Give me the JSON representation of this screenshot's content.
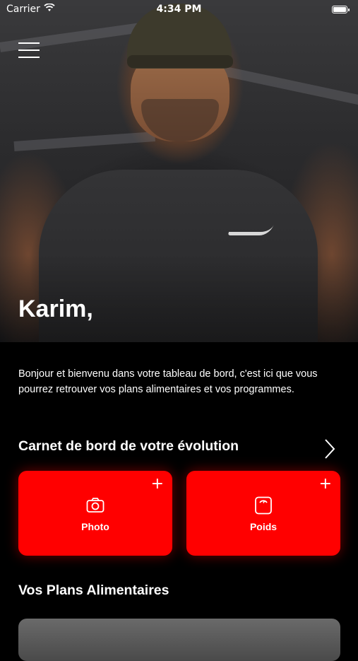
{
  "status_bar": {
    "carrier": "Carrier",
    "time": "4:34 PM"
  },
  "hero": {
    "greeting": "Karim,"
  },
  "intro": {
    "text": "Bonjour et bienvenu dans votre tableau de bord, c'est ici que vous pourrez retrouver vos plans alimentaires et vos programmes."
  },
  "evolution": {
    "title": "Carnet de bord de votre évolution",
    "cards": [
      {
        "label": "Photo",
        "icon": "camera-icon",
        "action_icon": "plus-icon"
      },
      {
        "label": "Poids",
        "icon": "scale-icon",
        "action_icon": "plus-icon"
      }
    ]
  },
  "plans": {
    "title": "Vos Plans Alimentaires"
  },
  "colors": {
    "accent": "#ff0000",
    "background": "#000000",
    "text": "#ffffff"
  }
}
